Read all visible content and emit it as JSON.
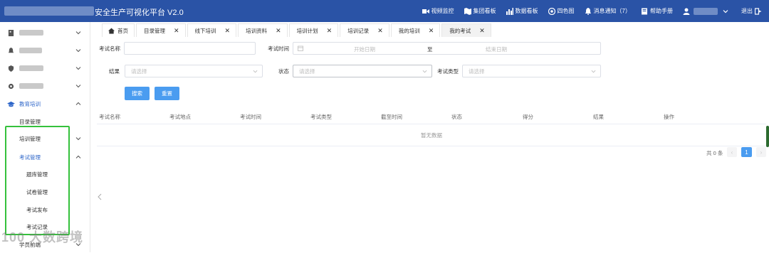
{
  "header": {
    "title": "安全生产可视化平台  V2.0",
    "nav": [
      {
        "label": "视频监控",
        "icon": "video-icon"
      },
      {
        "label": "集团看板",
        "icon": "map-icon"
      },
      {
        "label": "数据看板",
        "icon": "bar-chart-icon"
      },
      {
        "label": "四色图",
        "icon": "four-color-icon"
      },
      {
        "label": "消息通知（7）",
        "icon": "bell-icon"
      },
      {
        "label": "帮助手册",
        "icon": "book-icon"
      }
    ],
    "logout": "退出"
  },
  "sidebar": {
    "education": "教育培训",
    "catalog": "目录管理",
    "training": "培训管理",
    "exam": "考试管理",
    "question_bank": "题库管理",
    "paper": "试卷管理",
    "publish": "考试发布",
    "record": "考试记录",
    "student_clipped": "学员前端"
  },
  "tabs": [
    {
      "label": "首页"
    },
    {
      "label": "目录管理"
    },
    {
      "label": "线下培训"
    },
    {
      "label": "培训资料"
    },
    {
      "label": "培训计划"
    },
    {
      "label": "培训记录"
    },
    {
      "label": "我的培训"
    },
    {
      "label": "我的考试"
    }
  ],
  "form": {
    "exam_name_label": "考试名称",
    "exam_time_label": "考试时间",
    "start_placeholder": "开始日期",
    "to": "至",
    "end_placeholder": "结束日期",
    "result_label": "结果",
    "status_label": "状态",
    "type_label": "考试类型",
    "select_placeholder": "请选择",
    "search_btn": "搜索",
    "reset_btn": "重置"
  },
  "table": {
    "columns": [
      "考试名称",
      "考试地点",
      "考试时间",
      "考试类型",
      "截至时间",
      "状态",
      "得分",
      "结果",
      "操作"
    ],
    "empty_text": "暂无数据"
  },
  "pagination": {
    "total": "共 0 条",
    "current": "1",
    "prev": "‹",
    "next": "›"
  },
  "watermark": "100 大数跨境"
}
